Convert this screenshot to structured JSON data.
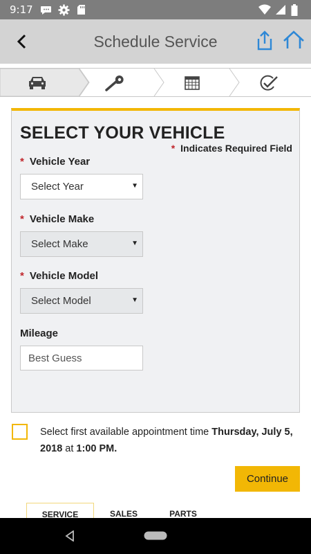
{
  "status_bar": {
    "time": "9:17"
  },
  "app_bar": {
    "title": "Schedule Service"
  },
  "steps": [
    {
      "icon": "car-icon"
    },
    {
      "icon": "wrench-icon"
    },
    {
      "icon": "calendar-icon"
    },
    {
      "icon": "check-circle-icon"
    }
  ],
  "form": {
    "heading": "SELECT YOUR VEHICLE",
    "required_star": "*",
    "required_note": "Indicates Required Field",
    "year": {
      "label": "Vehicle Year",
      "value": "Select Year"
    },
    "make": {
      "label": "Vehicle Make",
      "value": "Select Make"
    },
    "model": {
      "label": "Vehicle Model",
      "value": "Select Model"
    },
    "mileage": {
      "label": "Mileage",
      "placeholder": "Best Guess"
    },
    "caret": "▼"
  },
  "appointment": {
    "text": "Select first available appointment time ",
    "date": "Thursday, July 5, 2018",
    "at": " at ",
    "time": "1:00 PM."
  },
  "continue_label": "Continue",
  "tabs": [
    {
      "label": "SERVICE",
      "active": true
    },
    {
      "label": "SALES",
      "active": false
    },
    {
      "label": "PARTS",
      "active": false
    }
  ],
  "colors": {
    "accent": "#f2b705",
    "blue": "#2e88d6",
    "required": "#c0262c"
  }
}
